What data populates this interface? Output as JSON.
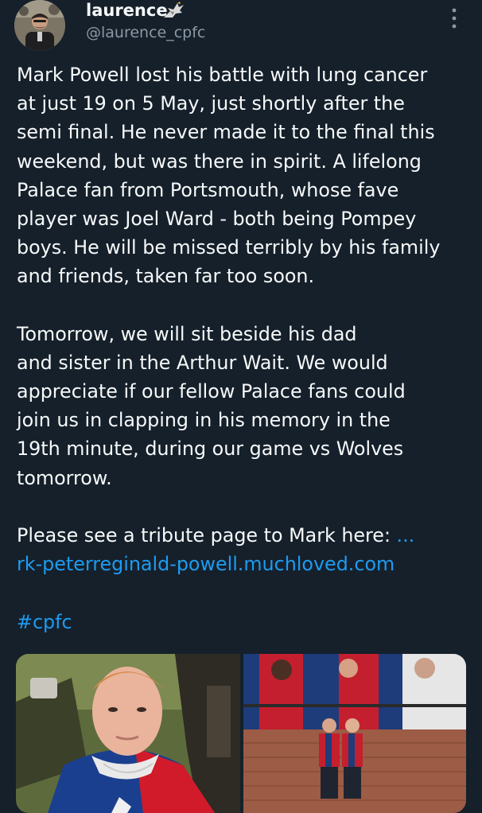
{
  "author": {
    "display_name": "laurence",
    "handle": "@laurence_cpfc",
    "avatar_icon": "profile-photo",
    "badge_icon": "eagle-icon",
    "more_icon": "more-vertical-icon"
  },
  "tweet": {
    "paragraph1": [
      "Mark Powell lost his battle with lung cancer",
      "at just 19 on 5 May, just shortly after the",
      "semi final. He never made it to the final this",
      "weekend, but was there in spirit. A lifelong",
      "Palace fan from Portsmouth, whose fave",
      "player was Joel Ward - both being Pompey",
      "boys. He will be missed terribly by his family",
      "and friends, taken far too soon."
    ],
    "paragraph2": [
      "Tomorrow, we will sit beside his dad",
      "and sister in the Arthur Wait. We would",
      "appreciate if our fellow Palace fans could",
      "join us in clapping in his memory in the",
      "19th minute, during our game vs Wolves",
      "tomorrow."
    ],
    "tribute_text": "Please see a tribute page to Mark here: ",
    "tribute_link_prefix": "...",
    "tribute_link_url": "rk-peterreginald-powell.muchloved.com",
    "hashtag": "#cpfc"
  },
  "media": {
    "images": [
      {
        "name": "photo-young-man-palace-shirt"
      },
      {
        "name": "photo-mural-two-fans"
      }
    ]
  },
  "colors": {
    "background": "#15202b",
    "text": "#f7f9f9",
    "secondary_text": "#8b98a5",
    "link": "#1d9bf0"
  }
}
